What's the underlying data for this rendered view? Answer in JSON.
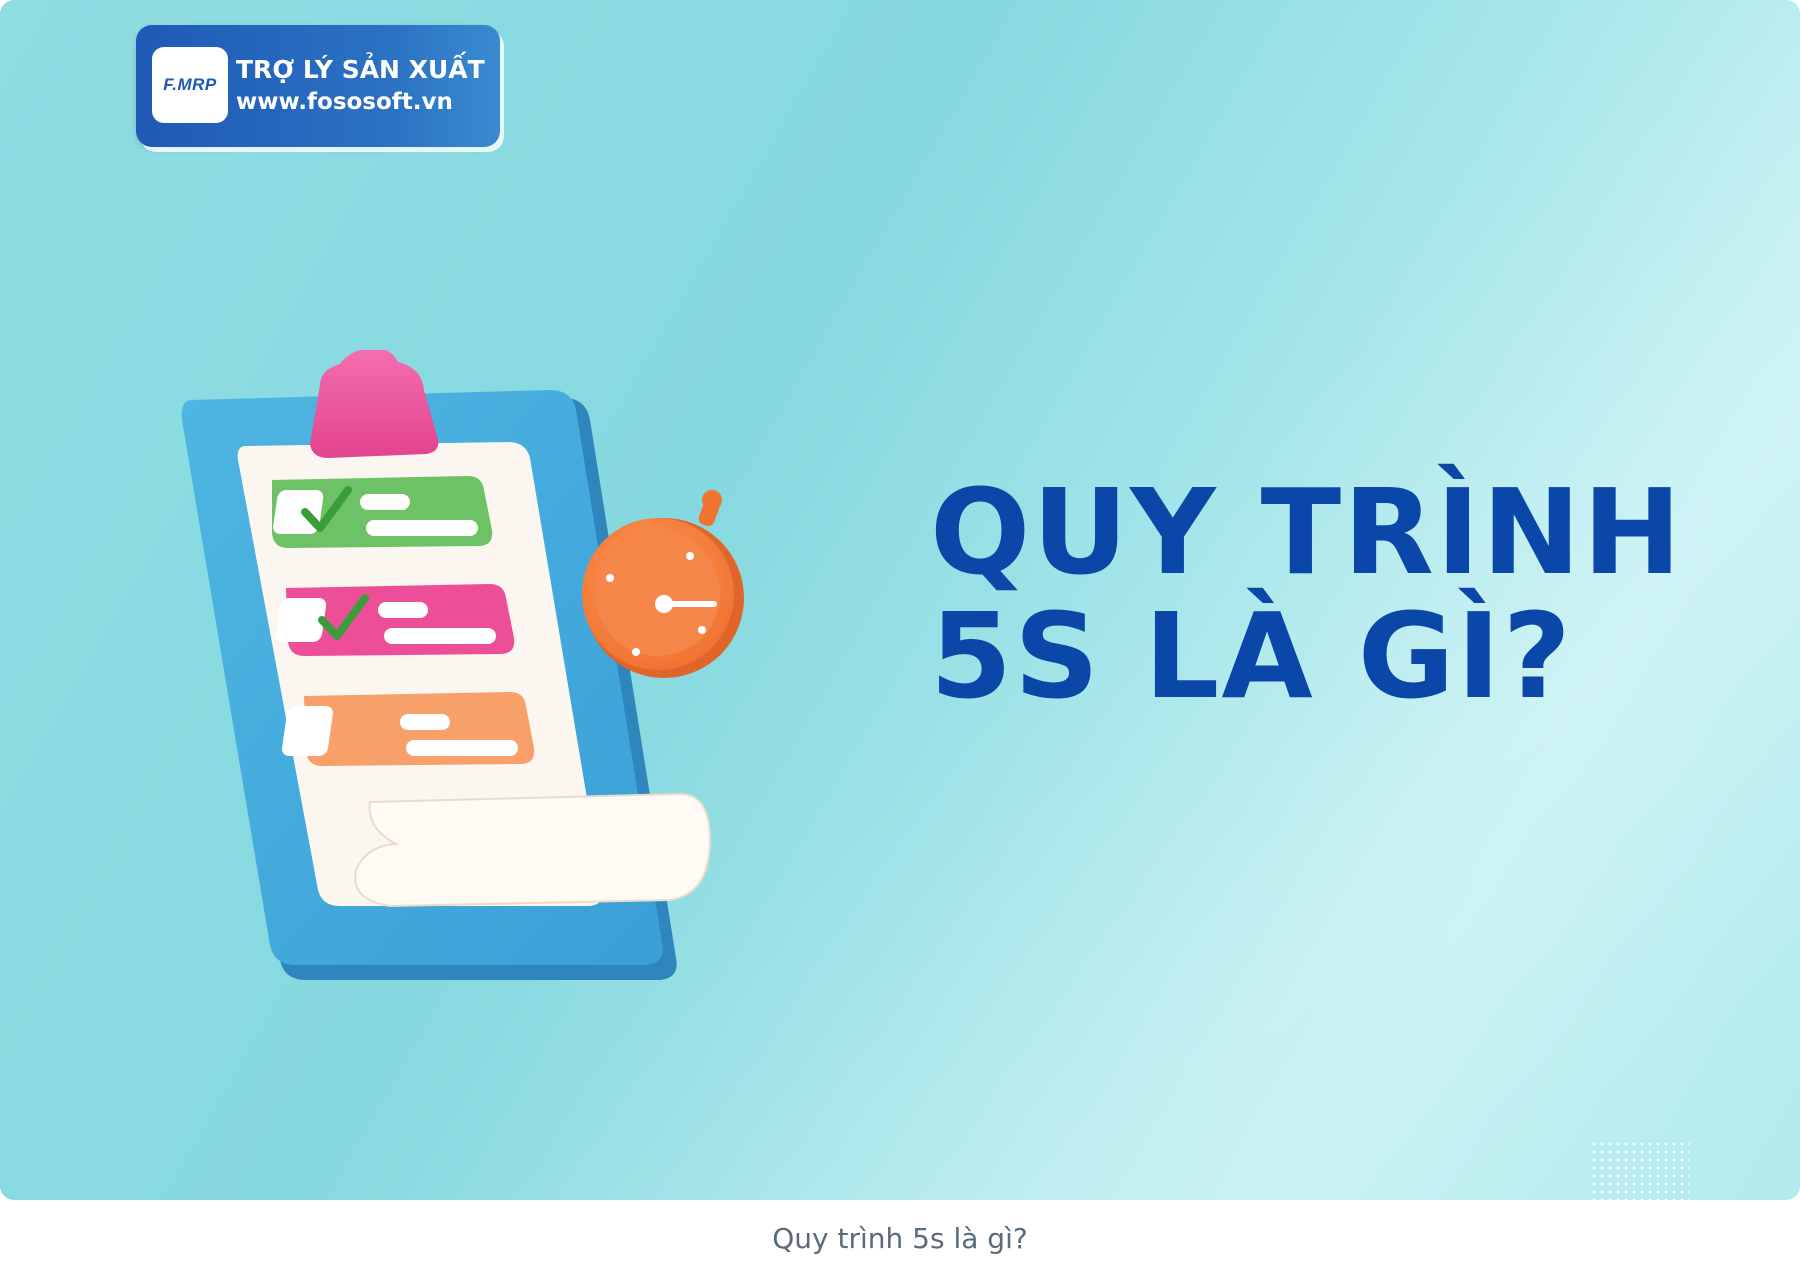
{
  "logo": {
    "mark_text": "F.MRP",
    "title": "TRỢ LÝ SẢN XUẤT",
    "url": "www.fososoft.vn"
  },
  "headline": {
    "line1": "QUY TRÌNH",
    "line2": "5S LÀ GÌ?"
  },
  "illustration": {
    "icons": [
      "clipboard-checklist-icon",
      "stopwatch-icon"
    ]
  },
  "colors": {
    "headline": "#0a47a8",
    "logo_bg": "#1f59b6",
    "background": "#8fdde3"
  },
  "caption": "Quy trình 5s là gì?"
}
